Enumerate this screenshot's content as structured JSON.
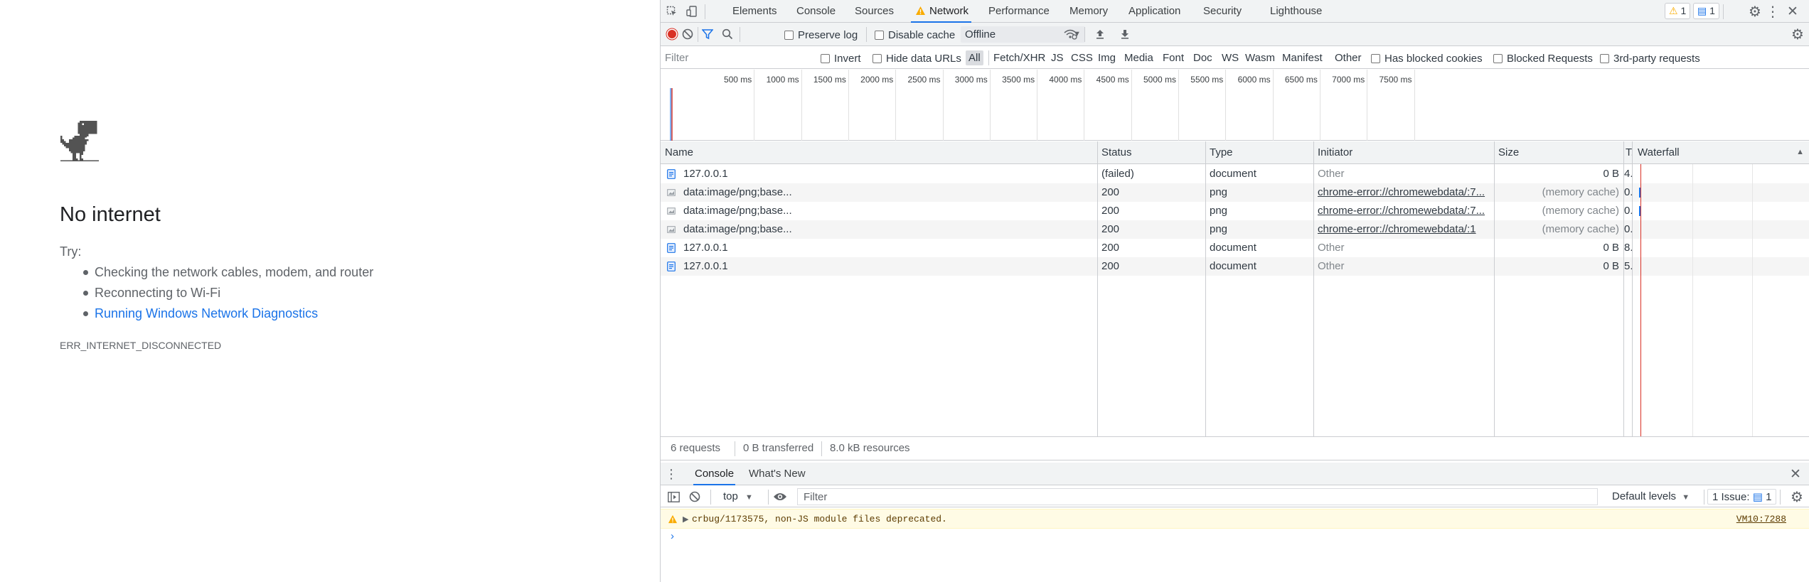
{
  "offline_page": {
    "icon": "dino-icon",
    "title": "No internet",
    "try_label": "Try:",
    "suggestions": [
      "Checking the network cables, modem, and router",
      "Reconnecting to Wi-Fi",
      "Running Windows Network Diagnostics"
    ],
    "error_code": "ERR_INTERNET_DISCONNECTED"
  },
  "devtools": {
    "tabs": [
      "Elements",
      "Console",
      "Sources",
      "Network",
      "Performance",
      "Memory",
      "Application",
      "Security",
      "Lighthouse"
    ],
    "active_tab": "Network",
    "warning_count": "1",
    "issue_count": "1",
    "toolbar": {
      "preserve_log": "Preserve log",
      "disable_cache": "Disable cache",
      "throttling": "Offline"
    },
    "filter_bar": {
      "placeholder": "Filter",
      "invert": "Invert",
      "hide_data_urls": "Hide data URLs",
      "types": [
        "All",
        "Fetch/XHR",
        "JS",
        "CSS",
        "Img",
        "Media",
        "Font",
        "Doc",
        "WS",
        "Wasm",
        "Manifest",
        "Other"
      ],
      "active_type": "All",
      "has_blocked_cookies": "Has blocked cookies",
      "blocked_requests": "Blocked Requests",
      "third_party": "3rd-party requests"
    },
    "timeline_ticks": [
      "500 ms",
      "1000 ms",
      "1500 ms",
      "2000 ms",
      "2500 ms",
      "3000 ms",
      "3500 ms",
      "4000 ms",
      "4500 ms",
      "5000 ms",
      "5500 ms",
      "6000 ms",
      "6500 ms",
      "7000 ms",
      "7500 ms"
    ],
    "columns": {
      "name": "Name",
      "status": "Status",
      "type": "Type",
      "initiator": "Initiator",
      "size": "Size",
      "time": "T.",
      "waterfall": "Waterfall"
    },
    "requests": [
      {
        "icon": "document-icon",
        "name": "127.0.0.1",
        "status": "(failed)",
        "type": "document",
        "initiator": "Other",
        "initiator_link": false,
        "size": "0 B",
        "time": "4..."
      },
      {
        "icon": "image-icon",
        "name": "data:image/png;base...",
        "status": "200",
        "type": "png",
        "initiator": "chrome-error://chromewebdata/:7...",
        "initiator_link": true,
        "size": "(memory cache)",
        "time": "0..."
      },
      {
        "icon": "image-icon",
        "name": "data:image/png;base...",
        "status": "200",
        "type": "png",
        "initiator": "chrome-error://chromewebdata/:7...",
        "initiator_link": true,
        "size": "(memory cache)",
        "time": "0..."
      },
      {
        "icon": "image-icon",
        "name": "data:image/png;base...",
        "status": "200",
        "type": "png",
        "initiator": "chrome-error://chromewebdata/:1",
        "initiator_link": true,
        "size": "(memory cache)",
        "time": "0..."
      },
      {
        "icon": "document-icon",
        "name": "127.0.0.1",
        "status": "200",
        "type": "document",
        "initiator": "Other",
        "initiator_link": false,
        "size": "0 B",
        "time": "8..."
      },
      {
        "icon": "document-icon",
        "name": "127.0.0.1",
        "status": "200",
        "type": "document",
        "initiator": "Other",
        "initiator_link": false,
        "size": "0 B",
        "time": "5..."
      }
    ],
    "summary": {
      "requests": "6 requests",
      "transferred": "0 B transferred",
      "resources": "8.0 kB resources"
    },
    "drawer": {
      "tabs": [
        "Console",
        "What's New"
      ],
      "active_tab": "Console",
      "context": "top",
      "filter_placeholder": "Filter",
      "levels": "Default levels",
      "issues": "1 Issue:",
      "issues_count": "1",
      "messages": [
        {
          "level": "warning",
          "text": "crbug/1173575, non-JS module files deprecated.",
          "source": "VM10:7288"
        }
      ],
      "prompt": "›"
    },
    "colors": {
      "accent": "#1a73e8",
      "record": "#d93025",
      "warning_bg": "#fffbe5",
      "warning_icon": "#f9ab00"
    }
  }
}
